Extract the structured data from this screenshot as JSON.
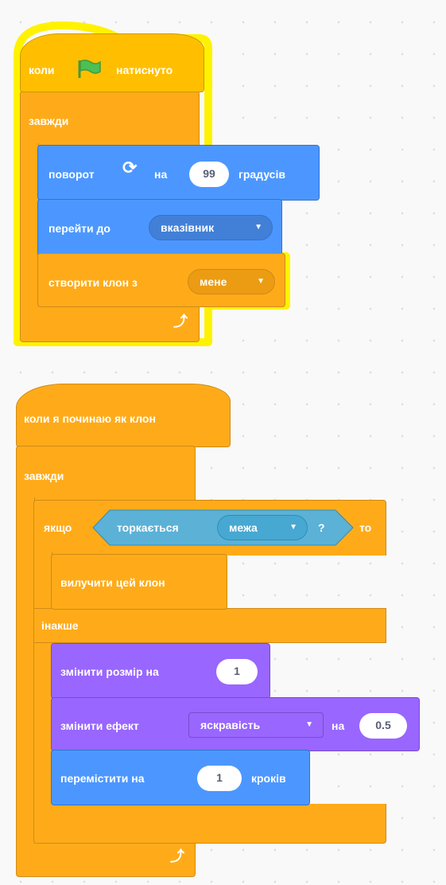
{
  "colors": {
    "events": "#ffbf00",
    "control": "#ffab19",
    "motion": "#4c97ff",
    "looks": "#9966ff",
    "sensing": "#5cb1d6",
    "glow": "#fff200"
  },
  "script1": {
    "hat": {
      "before": "коли",
      "after": "натиснуто",
      "icon": "green-flag-icon"
    },
    "forever_label": "завжди",
    "turn": {
      "label": "поворот",
      "on": "на",
      "value": "99",
      "unit": "градусів",
      "icon": "rotate-clockwise-icon"
    },
    "goto": {
      "label": "перейти до",
      "target": "вказівник"
    },
    "clone": {
      "label": "створити клон з",
      "target": "мене"
    },
    "loop_icon": "loop-arrow-icon"
  },
  "script2": {
    "hat": {
      "label": "коли я починаю як клон"
    },
    "forever_label": "завжди",
    "if": {
      "label": "якщо",
      "then": "то"
    },
    "touching": {
      "label": "торкається",
      "target": "межа",
      "question": "?"
    },
    "delete_clone": "вилучити цей клон",
    "else_label": "інакше",
    "change_size": {
      "label": "змінити розмір на",
      "value": "1"
    },
    "change_effect": {
      "label": "змінити ефект",
      "effect": "яскравість",
      "on": "на",
      "value": "0.5"
    },
    "move": {
      "label": "перемістити на",
      "value": "1",
      "unit": "кроків"
    },
    "loop_icon": "loop-arrow-icon"
  }
}
